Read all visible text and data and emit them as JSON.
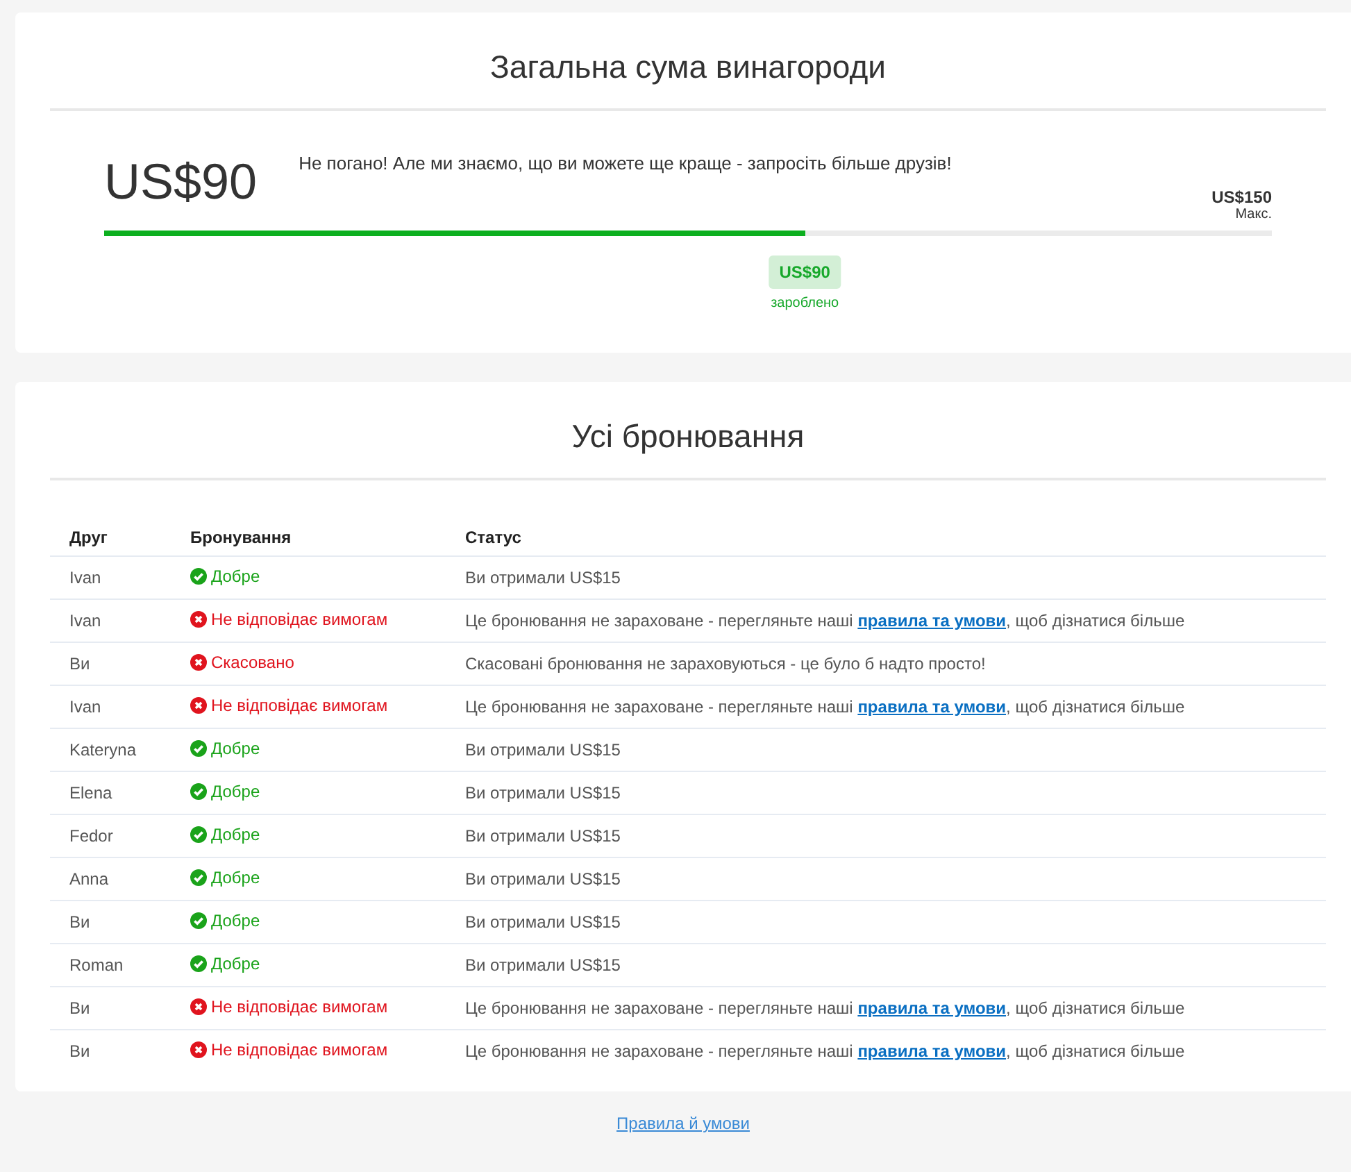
{
  "reward": {
    "title": "Загальна сума винагороди",
    "amount": "US$90",
    "message": "Не погано! Але ми знаємо, що ви можете ще краще - запросіть більше друзів!",
    "max_amount": "US$150",
    "max_label": "Макс.",
    "level": 0.6,
    "earned_amount": "US$90",
    "earned_label": "зароблено"
  },
  "bookings": {
    "title": "Усі бронювання",
    "columns": [
      "Друг",
      "Бронування",
      "Статус"
    ],
    "rows": [
      {
        "friend": "Ivan",
        "kind": "ok",
        "booking": "Добре",
        "status": "Ви отримали US$15"
      },
      {
        "friend": "Ivan",
        "kind": "fail",
        "booking": "Не відповідає вимогам",
        "status": "Це бронювання не зараховане - перегляньте наші ",
        "link": "правила та умови",
        "after": ", щоб дізнатися більше"
      },
      {
        "friend": "Ви",
        "kind": "fail",
        "booking": "Скасовано",
        "status": "Скасовані бронювання не зараховуються - це було б надто просто!"
      },
      {
        "friend": "Ivan",
        "kind": "fail",
        "booking": "Не відповідає вимогам",
        "status": "Це бронювання не зараховане - перегляньте наші ",
        "link": "правила та умови",
        "after": ", щоб дізнатися більше"
      },
      {
        "friend": "Kateryna",
        "kind": "ok",
        "booking": "Добре",
        "status": "Ви отримали US$15"
      },
      {
        "friend": "Elena",
        "kind": "ok",
        "booking": "Добре",
        "status": "Ви отримали US$15"
      },
      {
        "friend": "Fedor",
        "kind": "ok",
        "booking": "Добре",
        "status": "Ви отримали US$15"
      },
      {
        "friend": "Anna",
        "kind": "ok",
        "booking": "Добре",
        "status": "Ви отримали US$15"
      },
      {
        "friend": "Ви",
        "kind": "ok",
        "booking": "Добре",
        "status": "Ви отримали US$15"
      },
      {
        "friend": "Roman",
        "kind": "ok",
        "booking": "Добре",
        "status": "Ви отримали US$15"
      },
      {
        "friend": "Ви",
        "kind": "fail",
        "booking": "Не відповідає вимогам",
        "status": "Це бронювання не зараховане - перегляньте наші ",
        "link": "правила та умови",
        "after": ", щоб дізнатися більше"
      },
      {
        "friend": "Ви",
        "kind": "fail",
        "booking": "Не відповідає вимогам",
        "status": "Це бронювання не зараховане - перегляньте наші ",
        "link": "правила та умови",
        "after": ", щоб дізнатися більше"
      }
    ]
  },
  "footer_link": "Правила й умови"
}
